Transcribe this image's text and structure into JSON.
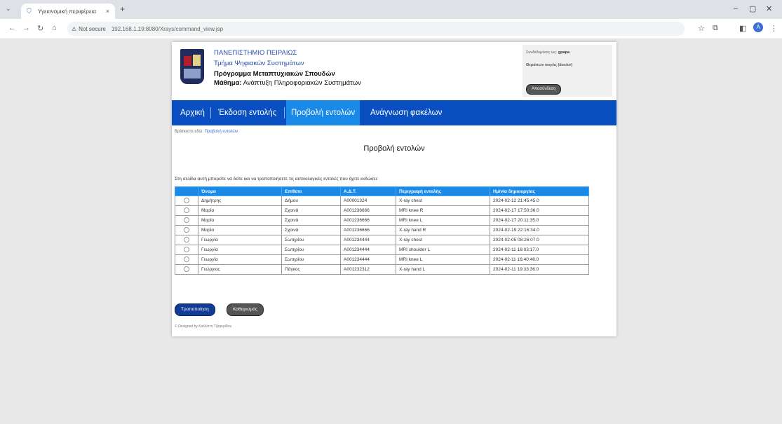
{
  "browser": {
    "tab_title": "Υγειονομική περιφέρεια",
    "tab_close": "×",
    "new_tab": "+",
    "not_secure": "Not secure",
    "url": "192.168.1.19:8080/Xrays/command_view.jsp",
    "win_min": "–",
    "win_max": "▢",
    "win_close": "✕",
    "profile_initial": "A"
  },
  "header": {
    "line1": "ΠΑΝΕΠΙΣΤΗΜΙΟ ΠΕΙΡΑΙΩΣ",
    "line2": "Τμήμα Ψηφιακών Συστημάτων",
    "line3": "Πρόγραμμα Μεταπτυχιακών Σπουδών",
    "course_label": "Μάθημα:",
    "course_name": "Ανάπτυξη Πληροφοριακών Συστημάτων"
  },
  "user": {
    "connected_label": "Συνδεδεμένος ως:",
    "username": "gpapa",
    "role": "Θεράπων ιατρός (doctor)",
    "logout": "Αποσύνδεση"
  },
  "nav": {
    "home": "Αρχική",
    "issue": "Έκδοση εντολής",
    "view": "Προβολή εντολών",
    "folders": "Ανάγνωση φακέλων"
  },
  "breadcrumb": {
    "prefix": "Βρίσκεστε εδώ:",
    "current": "Προβολή εντολών"
  },
  "page_title": "Προβολή εντολών",
  "intro": "Στη σελίδα αυτή μπορείτε να δείτε και να τροποποιήσετε τις ακτινολογικές εντολές που έχετε εκδώσει:",
  "table": {
    "headers": [
      "Όνομα",
      "Επίθετο",
      "Α.Δ.Τ.",
      "Περιγραφή εντολής",
      "Ημ/νία δημιουργίας"
    ],
    "rows": [
      [
        "Δημήτρης",
        "Δήμου",
        "Α00001324",
        "X-ray chest",
        "2024-02-12 21:45:45.0"
      ],
      [
        "Μαρία",
        "Σχοινά",
        "Α001236666",
        "MRI knee R",
        "2024-02-17 17:50:36.0"
      ],
      [
        "Μαρία",
        "Σχοινά",
        "Α001236666",
        "MRI knee L",
        "2024-02-17 20:11:35.0"
      ],
      [
        "Μαρία",
        "Σχοινά",
        "Α001236666",
        "X-ray hand R",
        "2024-02-19 22:16:34.0"
      ],
      [
        "Γεωργία",
        "Σωτηρίου",
        "Α001234444",
        "X-ray chest",
        "2024-02-05 08:26:07.0"
      ],
      [
        "Γεωργία",
        "Σωτηρίου",
        "Α001234444",
        "MRI shoulder L",
        "2024-02-11 16:03:17.0"
      ],
      [
        "Γεωργία",
        "Σωτηρίου",
        "Α001234444",
        "MRI knee L",
        "2024-02-11 16:40:48.0"
      ],
      [
        "Γεώργιος",
        "Πάγκος",
        "Α001232312",
        "X-ray hand L",
        "2024-02-11 19:33:36.0"
      ]
    ]
  },
  "buttons": {
    "edit": "Τροποποίηση",
    "clear": "Καθαρισμός"
  },
  "footer": "© Designed by Καλλίστη Τζαφερίδου",
  "colors": {
    "nav_bg": "#0a4fc2",
    "nav_active": "#1a8ae8",
    "table_header": "#1a8ae8"
  }
}
